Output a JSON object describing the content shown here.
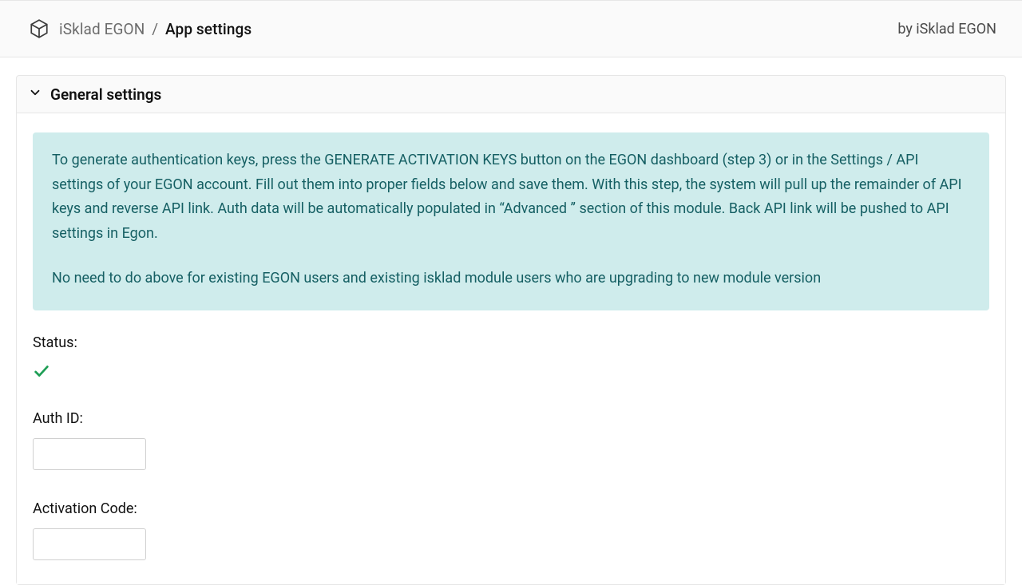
{
  "header": {
    "app_name": "iSklad EGON",
    "breadcrumb_separator": "/",
    "page_title": "App settings",
    "byline": "by iSklad EGON"
  },
  "panel": {
    "title": "General settings",
    "alert": {
      "p1": "To generate authentication keys, press the GENERATE ACTIVATION KEYS button on the EGON dashboard (step 3) or in the Settings / API settings of your EGON account. Fill out them into proper fields below and save them. With this step, the system will pull up the remainder of API keys and reverse API link. Auth data will be automatically populated in “Advanced ” section of this module. Back API link will be pushed to API settings in Egon.",
      "p2": "No need to do above for existing EGON users and existing isklad module users who are upgrading to new module version"
    },
    "fields": {
      "status_label": "Status:",
      "status_value": "ok",
      "auth_id_label": "Auth ID:",
      "auth_id_value": "",
      "activation_code_label": "Activation Code:",
      "activation_code_value": ""
    }
  }
}
